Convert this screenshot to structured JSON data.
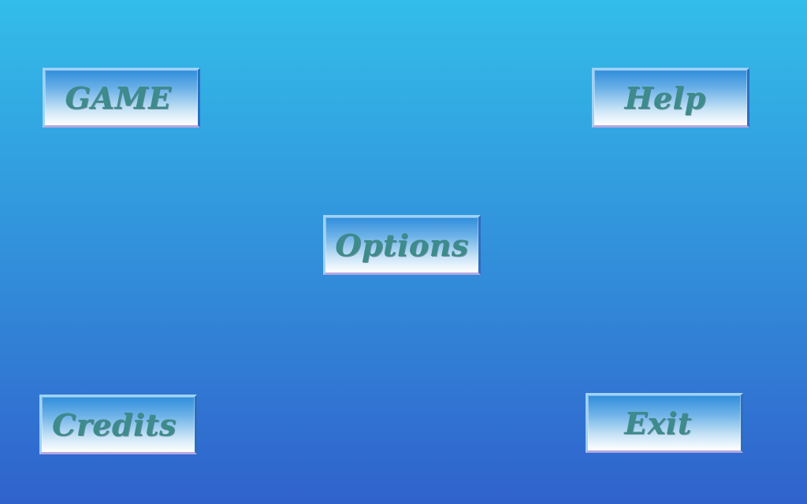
{
  "menu": {
    "game_label": "GAME",
    "help_label": "Help",
    "options_label": "Options",
    "credits_label": "Credits",
    "exit_label": "Exit"
  },
  "colors": {
    "background_top": "#33bde9",
    "background_bottom": "#3062cc",
    "button_label": "#3d8b8a"
  }
}
